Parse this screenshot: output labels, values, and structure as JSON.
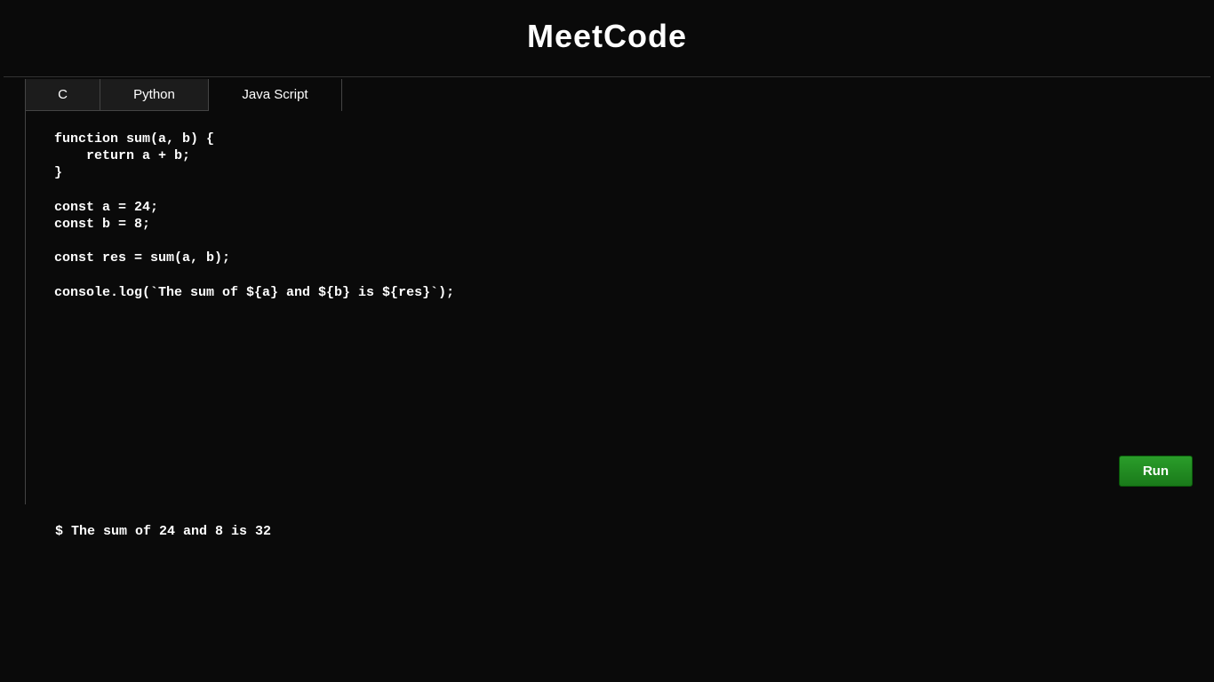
{
  "header": {
    "title": "MeetCode"
  },
  "tabs": [
    {
      "label": "C",
      "active": false
    },
    {
      "label": "Python",
      "active": false
    },
    {
      "label": "Java Script",
      "active": true
    }
  ],
  "editor": {
    "code": "function sum(a, b) {\n    return a + b;\n}\n\nconst a = 24;\nconst b = 8;\n\nconst res = sum(a, b);\n\nconsole.log(`The sum of ${a} and ${b} is ${res}`);"
  },
  "buttons": {
    "run_label": "Run"
  },
  "output": {
    "text": "$ The sum of 24 and 8 is 32"
  }
}
